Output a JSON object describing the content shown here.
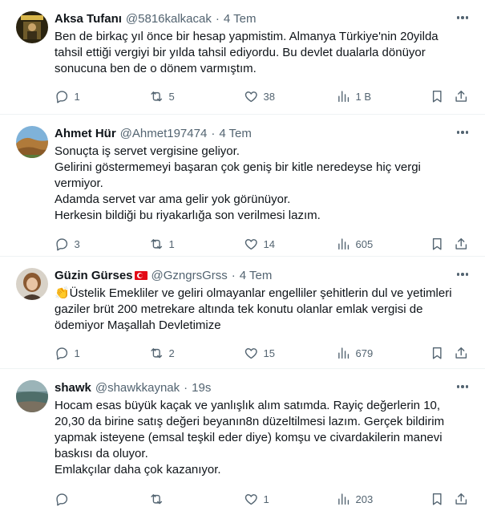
{
  "tweets": [
    {
      "name": "Aksa Tufanı",
      "handle": "@5816kalkacak",
      "time": "4 Tem",
      "lines": [
        "Ben de birkaç yıl önce bir hesap yapmistim. Almanya Türkiye'nin 20yilda",
        "tahsil ettiği vergiyi bir yılda tahsil ediyordu. Bu devlet dualarla dönüyor",
        "sonucuna ben de o dönem varmıştım."
      ],
      "replies": "1",
      "reposts": "5",
      "likes": "38",
      "views": "1 B",
      "avatar_icon": "poster-avatar"
    },
    {
      "name": "Ahmet Hür",
      "handle": "@Ahmet197474",
      "time": "4 Tem",
      "lines": [
        "Sonuçta iş servet vergisine geliyor.",
        "Gelirini göstermemeyi başaran çok geniş bir kitle neredeyse hiç vergi",
        "vermiyor.",
        "Adamda servet var ama gelir yok görünüyor.",
        "Herkesin bildiği bu riyakarlığa son verilmesi lazım."
      ],
      "replies": "3",
      "reposts": "1",
      "likes": "14",
      "views": "605",
      "avatar_icon": "landscape-avatar"
    },
    {
      "name": "Güzin Gürses",
      "handle": "@GzngrsGrss",
      "time": "4 Tem",
      "lines": [
        "👏Üstelik Emekliler ve geliri olmayanlar engelliler şehitlerin dul ve yetimleri",
        "gaziler brüt 200 metrekare altında tek konutu olanlar emlak vergisi de",
        "ödemiyor Maşallah Devletimize"
      ],
      "replies": "1",
      "reposts": "2",
      "likes": "15",
      "views": "679",
      "avatar_icon": "person-avatar",
      "flag": "turkey-flag-icon"
    },
    {
      "name": "shawk",
      "handle": "@shawkkaynak",
      "time": "19s",
      "lines": [
        "Hocam esas büyük kaçak ve yanlışlık alım satımda. Rayiç değerlerin 10,",
        "20,30 da birine satış değeri beyanın8n düzeltilmesi lazım. Gerçek bildirim",
        "yapmak isteyene (emsal teşkil eder diye) komşu ve civardakilerin manevi",
        "baskısı da oluyor.",
        "Emlakçılar daha çok kazanıyor."
      ],
      "replies": "",
      "reposts": "",
      "likes": "1",
      "views": "203",
      "avatar_icon": "sea-avatar"
    }
  ],
  "colors": {
    "text": "#0f1419",
    "muted": "#536471",
    "divider": "#eff3f4"
  }
}
